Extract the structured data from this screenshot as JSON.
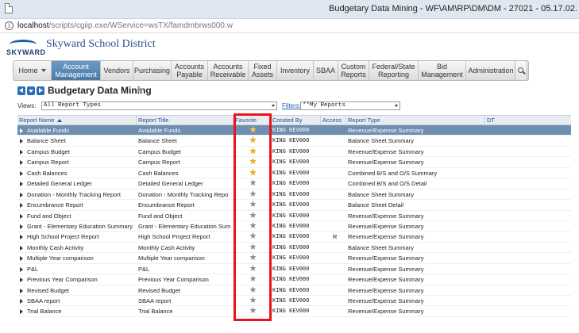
{
  "window": {
    "title": "Budgetary Data Mining - WF\\AM\\RP\\DM\\DM - 27021 - 05.17.02."
  },
  "address": {
    "host": "localhost",
    "path": "/scripts/cgiip.exe/WService=wsTX/famdmbrws000.w"
  },
  "brand": {
    "logo_text": "SKYWARD",
    "district": "Skyward School District"
  },
  "nav": {
    "items": [
      {
        "label": "Home"
      },
      {
        "label": "Account Management"
      },
      {
        "label": "Vendors"
      },
      {
        "label": "Purchasing"
      },
      {
        "label": "Accounts Payable"
      },
      {
        "label": "Accounts Receivable"
      },
      {
        "label": "Fixed Assets"
      },
      {
        "label": "Inventory"
      },
      {
        "label": "SBAA"
      },
      {
        "label": "Custom Reports"
      },
      {
        "label": "Federal/State Reporting"
      },
      {
        "label": "Bid Management"
      },
      {
        "label": "Administration"
      }
    ]
  },
  "page": {
    "title": "Budgetary Data Mining"
  },
  "filters": {
    "views_label": "Views:",
    "views_value": "All Report Types",
    "filters_label": "Filters:",
    "filters_value": "**My Reports"
  },
  "grid": {
    "columns": {
      "report_name": "Report Name",
      "report_title": "Report Title",
      "favorite": "Favorite",
      "created_by": "Created By",
      "access": "Access",
      "report_type": "Report Type",
      "dt": "DT"
    },
    "rows": [
      {
        "name": "Available Funds",
        "title": "Available Funds",
        "favorite": true,
        "created_by": "KING KEV000",
        "access": "",
        "type": "Revenue/Expense Summary"
      },
      {
        "name": "Balance Sheet",
        "title": "Balance Sheet",
        "favorite": true,
        "created_by": "KING KEV000",
        "access": "",
        "type": "Balance Sheet Summary"
      },
      {
        "name": "Campus Budget",
        "title": "Campus Budget",
        "favorite": true,
        "created_by": "KING KEV000",
        "access": "",
        "type": "Revenue/Expense Summary"
      },
      {
        "name": "Campus Report",
        "title": "Campus Report",
        "favorite": true,
        "created_by": "KING KEV000",
        "access": "",
        "type": "Revenue/Expense Summary"
      },
      {
        "name": "Cash Balances",
        "title": "Cash Balances",
        "favorite": true,
        "created_by": "KING KEV000",
        "access": "",
        "type": "Combined B/S and O/S Summary"
      },
      {
        "name": "Detailed General Ledger",
        "title": "Detailed General Ledger",
        "favorite": false,
        "created_by": "KING KEV000",
        "access": "",
        "type": "Combined B/S and O/S Detail"
      },
      {
        "name": "Donation - Monthly Tracking Report",
        "title": "Donation - Monthly Tracking Repo",
        "favorite": false,
        "created_by": "KING KEV000",
        "access": "",
        "type": "Balance Sheet Summary"
      },
      {
        "name": "Encumbrance Report",
        "title": "Encumbrance Report",
        "favorite": false,
        "created_by": "KING KEV000",
        "access": "",
        "type": "Balance Sheet Detail"
      },
      {
        "name": "Fund and Object",
        "title": "Fund and Object",
        "favorite": false,
        "created_by": "KING KEV000",
        "access": "",
        "type": "Revenue/Expense Summary"
      },
      {
        "name": "Grant - Elementary Education Summary",
        "title": "Grant - Elementary Education Sum",
        "favorite": false,
        "created_by": "KING KEV000",
        "access": "",
        "type": "Revenue/Expense Summary"
      },
      {
        "name": "High School Project Report",
        "title": "High School Project Report",
        "favorite": false,
        "created_by": "KING KEV000",
        "access": "R",
        "type": "Revenue/Expense Summary"
      },
      {
        "name": "Monthly Cash Activity",
        "title": "Monthly Cash Activity",
        "favorite": false,
        "created_by": "KING KEV000",
        "access": "",
        "type": "Balance Sheet Summary"
      },
      {
        "name": "Multiple Year comparison",
        "title": "Multiple Year comparison",
        "favorite": false,
        "created_by": "KING KEV000",
        "access": "",
        "type": "Revenue/Expense Summary"
      },
      {
        "name": "P&L",
        "title": "P&L",
        "favorite": false,
        "created_by": "KING KEV000",
        "access": "",
        "type": "Revenue/Expense Summary"
      },
      {
        "name": "Previous Year Comparison",
        "title": "Previous Year Comparison",
        "favorite": false,
        "created_by": "KING KEV000",
        "access": "",
        "type": "Revenue/Expense Summary"
      },
      {
        "name": "Revised Budget",
        "title": "Revised Budget",
        "favorite": false,
        "created_by": "KING KEV000",
        "access": "",
        "type": "Revenue/Expense Summary"
      },
      {
        "name": "SBAA report",
        "title": "SBAA report",
        "favorite": false,
        "created_by": "KING KEV000",
        "access": "",
        "type": "Revenue/Expense Summary"
      },
      {
        "name": "Trial Balance",
        "title": "Trial Balance",
        "favorite": false,
        "created_by": "KING KEV000",
        "access": "",
        "type": "Revenue/Expense Summary"
      }
    ]
  },
  "colors": {
    "accent": "#4b78a6",
    "selected_row": "#6f8fb2",
    "favorite_on": "#f0b11d",
    "favorite_off": "#8a8a8a",
    "highlight": "#e8141b"
  }
}
